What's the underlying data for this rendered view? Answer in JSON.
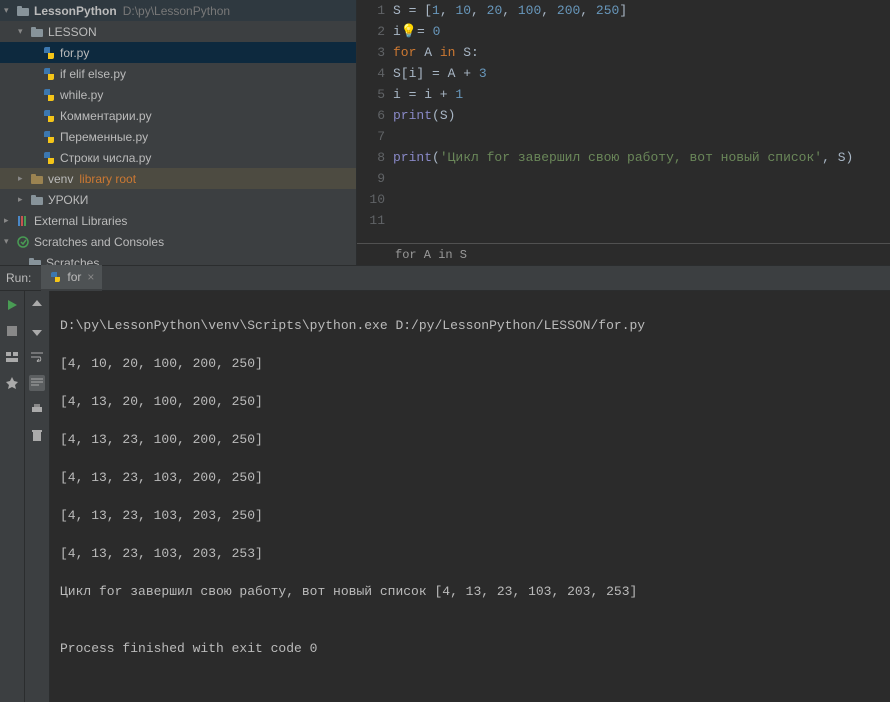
{
  "tree": {
    "root": {
      "name": "LessonPython",
      "path": "D:\\py\\LessonPython"
    },
    "lesson": {
      "name": "LESSON"
    },
    "files": [
      {
        "name": "for.py",
        "sel": true
      },
      {
        "name": "if elif else.py"
      },
      {
        "name": "while.py"
      },
      {
        "name": "Комментарии.py"
      },
      {
        "name": "Переменные.py"
      },
      {
        "name": "Строки числа.py"
      }
    ],
    "venv": {
      "name": "venv",
      "label": "library root"
    },
    "uroki": {
      "name": "УРОКИ"
    },
    "ext": {
      "name": "External Libraries"
    },
    "scratches_root": {
      "name": "Scratches and Consoles"
    },
    "scratches": {
      "name": "Scratches"
    }
  },
  "code": {
    "line1_a": "S = [",
    "line1_b": "1",
    "line1_c": ", ",
    "line1_d": "10",
    "line1_e": ", ",
    "line1_f": "20",
    "line1_g": ", ",
    "line1_h": "100",
    "line1_i": ", ",
    "line1_j": "200",
    "line1_k": ", ",
    "line1_l": "250",
    "line1_m": "]",
    "line2_a": "i",
    "line2_b": "= ",
    "line2_c": "0",
    "line3_a": "for ",
    "line3_b": "A ",
    "line3_c": "in ",
    "line3_d": "S:",
    "line4_a": "    S[i] = A + ",
    "line4_b": "3",
    "line5_a": "    i = i + ",
    "line5_b": "1",
    "line6_a": "    ",
    "line6_b": "print",
    "line6_c": "(S)",
    "line8_a": "print",
    "line8_b": "(",
    "line8_c": "'Цикл for завершил свою работу, вот новый список'",
    "line8_d": ", S)"
  },
  "lines": {
    "l1": "1",
    "l2": "2",
    "l3": "3",
    "l4": "4",
    "l5": "5",
    "l6": "6",
    "l7": "7",
    "l8": "8",
    "l9": "9",
    "l10": "10",
    "l11": "11"
  },
  "crumb": "for A in S",
  "run": {
    "label": "Run:",
    "tab": "for"
  },
  "console": {
    "cmd": "D:\\py\\LessonPython\\venv\\Scripts\\python.exe D:/py/LessonPython/LESSON/for.py",
    "l1": "[4, 10, 20, 100, 200, 250]",
    "l2": "[4, 13, 20, 100, 200, 250]",
    "l3": "[4, 13, 23, 100, 200, 250]",
    "l4": "[4, 13, 23, 103, 200, 250]",
    "l5": "[4, 13, 23, 103, 203, 250]",
    "l6": "[4, 13, 23, 103, 203, 253]",
    "l7": "Цикл for завершил свою работу, вот новый список [4, 13, 23, 103, 203, 253]",
    "l8": "",
    "l9": "Process finished with exit code 0"
  }
}
